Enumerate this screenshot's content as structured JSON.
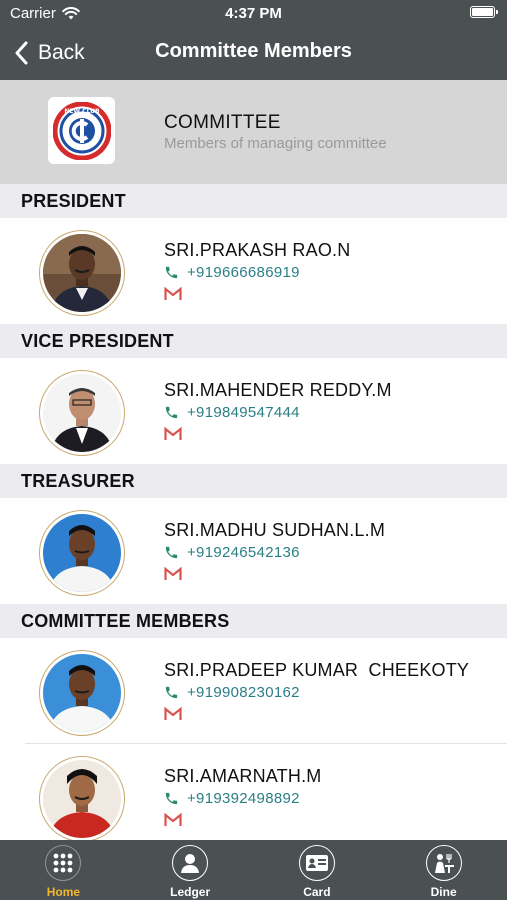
{
  "status_bar": {
    "carrier": "Carrier",
    "time": "4:37 PM"
  },
  "nav": {
    "back_label": "Back",
    "title": "Committee Members"
  },
  "banner": {
    "title": "COMMITTEE",
    "subtitle": "Members of managing committee",
    "logo_icon": "club-logo-icon",
    "logo_text_top": "NEW CLUB"
  },
  "sections": [
    {
      "title": "PRESIDENT",
      "members": [
        {
          "name": "SRI.PRAKASH RAO.N",
          "phone": "+919666686919"
        }
      ]
    },
    {
      "title": "VICE PRESIDENT",
      "members": [
        {
          "name": "SRI.MAHENDER REDDY.M",
          "phone": "+919849547444"
        }
      ]
    },
    {
      "title": "TREASURER",
      "members": [
        {
          "name": "SRI.MADHU SUDHAN.L.M",
          "phone": "+919246542136"
        }
      ]
    },
    {
      "title": "COMMITTEE MEMBERS",
      "members": [
        {
          "name": "SRI.PRADEEP KUMAR  CHEEKOTY",
          "phone": "+919908230162"
        },
        {
          "name": "SRI.AMARNATH.M",
          "phone": "+919392498892"
        }
      ]
    }
  ],
  "tabs": [
    {
      "label": "Home",
      "icon": "grid-icon"
    },
    {
      "label": "Ledger",
      "icon": "person-icon"
    },
    {
      "label": "Card",
      "icon": "card-icon"
    },
    {
      "label": "Dine",
      "icon": "dine-icon"
    }
  ],
  "colors": {
    "header_bg": "#4b5153",
    "banner_bg": "#d6d6d6",
    "section_bg": "#ececf0",
    "phone_text": "#2a7f85",
    "active_tab": "#f2b731",
    "avatar_ring": "#c7a86e",
    "mail_red": "#d9534f"
  }
}
